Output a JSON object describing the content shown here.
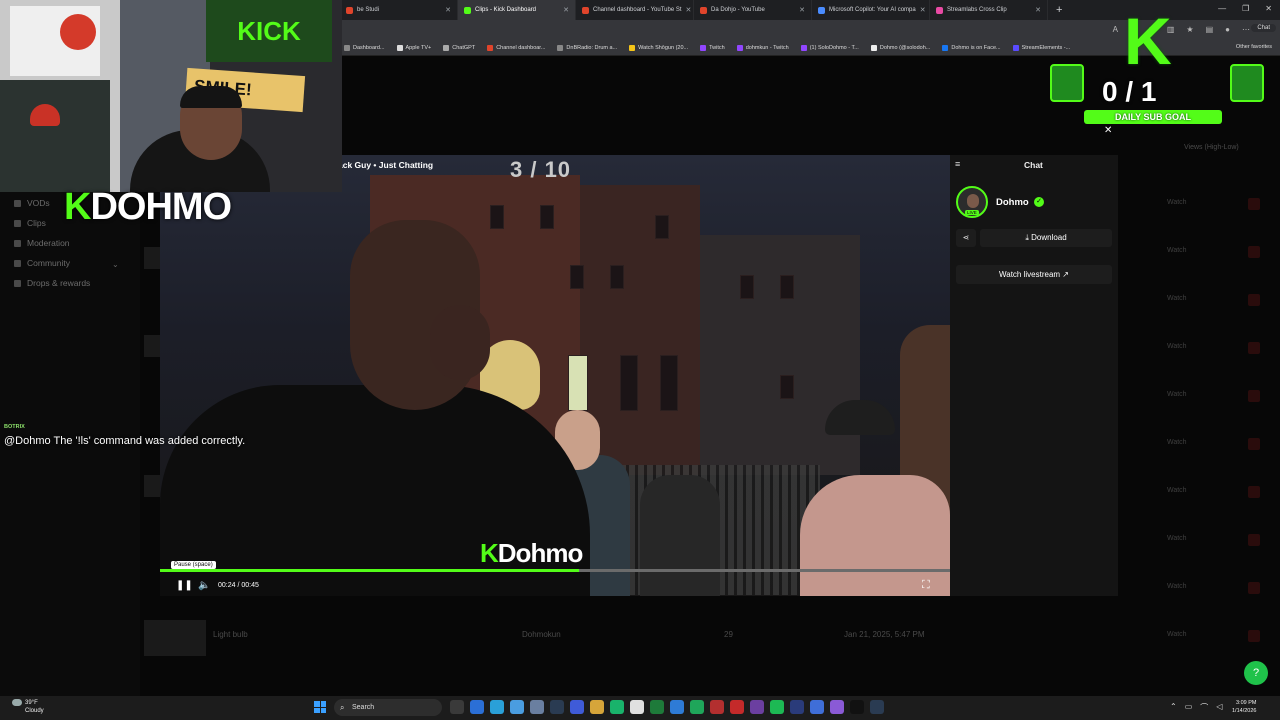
{
  "browser": {
    "tabs": [
      {
        "label": "be Studi",
        "active": false,
        "color": "#e0442b"
      },
      {
        "label": "Clips - Kick Dashboard",
        "active": true,
        "color": "#53fc18"
      },
      {
        "label": "Channel dashboard - YouTube St",
        "active": false,
        "color": "#e0442b"
      },
      {
        "label": "Da Dohjo - YouTube",
        "active": false,
        "color": "#e0442b"
      },
      {
        "label": "Microsoft Copilot: Your AI compa",
        "active": false,
        "color": "#4a8cff"
      },
      {
        "label": "Streamlabs Cross Clip",
        "active": false,
        "color": "#e94aa4"
      }
    ],
    "bookmarks": [
      {
        "label": "Dashboard...",
        "color": "#888"
      },
      {
        "label": "Apple TV+",
        "color": "#ddd"
      },
      {
        "label": "ChatGPT",
        "color": "#aaa"
      },
      {
        "label": "Channel dashboar...",
        "color": "#e0442b"
      },
      {
        "label": "DnBRadio: Drum a...",
        "color": "#888"
      },
      {
        "label": "Watch Shōgun (20...",
        "color": "#f5c518"
      },
      {
        "label": "Twitch",
        "color": "#9146ff"
      },
      {
        "label": "dohmkun - Twitch",
        "color": "#9146ff"
      },
      {
        "label": "(1) SoloDohmo - T...",
        "color": "#9146ff"
      },
      {
        "label": "Dohmo (@solodoh...",
        "color": "#eee"
      },
      {
        "label": "Dohmo is on Face...",
        "color": "#1877f2"
      },
      {
        "label": "StreamElements -...",
        "color": "#5a4bff"
      }
    ],
    "other_favorites": "Other favorites",
    "chat_label": "Chat"
  },
  "sidebar": {
    "items": [
      {
        "label": "VODs"
      },
      {
        "label": "Clips"
      },
      {
        "label": "Moderation"
      },
      {
        "label": "Community"
      },
      {
        "label": "Drops & rewards"
      }
    ]
  },
  "clips_list": {
    "sort_label": "Views (High-Low)",
    "watch_label": "Watch",
    "last_row": {
      "title": "Light bulb",
      "author": "Dohmokun",
      "views": "29",
      "date": "Jan 21, 2025, 5:47 PM"
    }
  },
  "player": {
    "title": "ack Guy • Just Chatting",
    "counter": "3 / 10",
    "watermark_k": "K",
    "watermark_text": "Dohmo",
    "tooltip": "Pause (space)",
    "time": "00:24 / 00:45",
    "progress_percent": 53
  },
  "panel": {
    "header": "Chat",
    "channel": "Dohmo",
    "live_badge": "LIVE",
    "download_label": "Download",
    "watch_livestream_label": "Watch livestream"
  },
  "overlay": {
    "logo_k": "K",
    "logo_text": "DOHMO",
    "webcam_sign_kick": "KICK",
    "webcam_sign_smile": "SMILE!",
    "bot_name": "BOTRIX",
    "bot_message": "@Dohmo The '!ls' command was added correctly.",
    "sub_goal_k": "K",
    "sub_goal_count": "0 / 1",
    "sub_goal_label": "DAILY SUB GOAL"
  },
  "taskbar": {
    "weather_temp": "39°F",
    "weather_desc": "Cloudy",
    "search_placeholder": "Search",
    "time": "3:09 PM",
    "date": "1/14/2026"
  },
  "colors": {
    "kick_green": "#53fc18",
    "panel_bg": "#141414"
  }
}
